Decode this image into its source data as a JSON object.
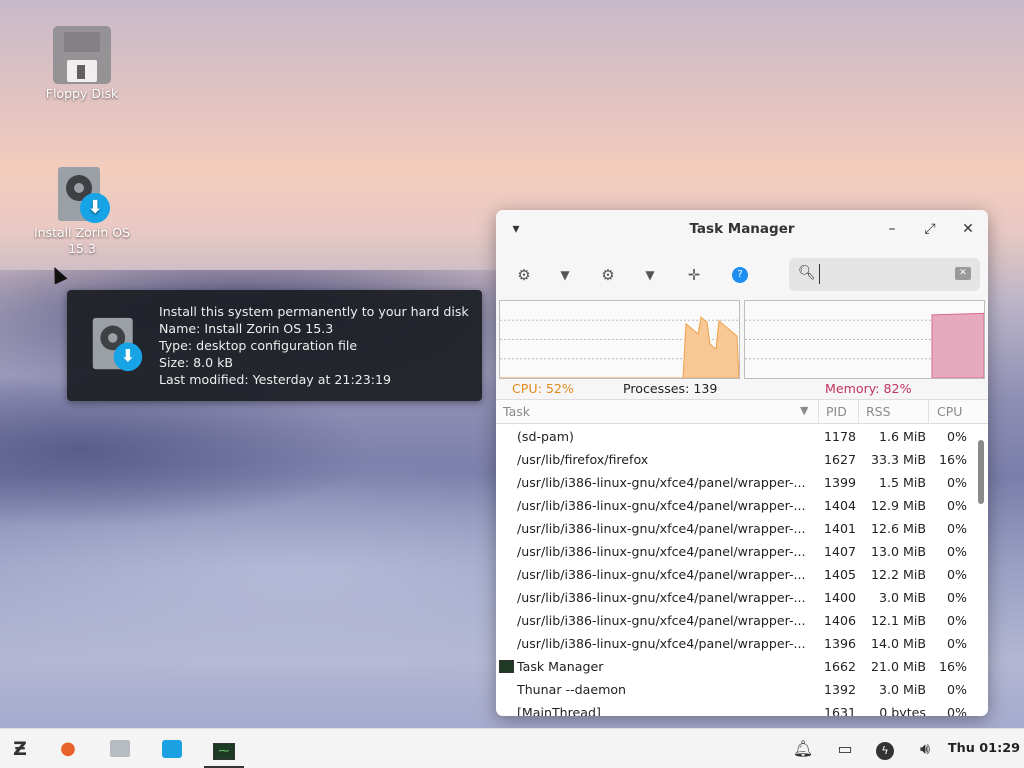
{
  "desktop": {
    "icons": [
      {
        "label": "Floppy Disk"
      },
      {
        "label": "Install Zorin OS 15.3"
      }
    ]
  },
  "tooltip": {
    "lines": [
      "Install this system permanently to your hard disk",
      "Name: Install Zorin OS 15.3",
      "Type: desktop configuration file",
      "Size: 8.0 kB",
      "Last modified: Yesterday at 21:23:19"
    ]
  },
  "window": {
    "title": "Task Manager",
    "search": {
      "value": "",
      "placeholder": ""
    },
    "stats": {
      "cpu": "CPU: 52%",
      "processes": "Processes: 139",
      "memory": "Memory: 82%"
    },
    "cpu_usage_percent": 52,
    "memory_usage_percent": 82,
    "columns": [
      "Task",
      "PID",
      "RSS",
      "CPU"
    ],
    "rows": [
      {
        "task": "(sd-pam)",
        "pid": "1178",
        "rss": "1.6 MiB",
        "cpu": "0%"
      },
      {
        "task": "/usr/lib/firefox/firefox",
        "pid": "1627",
        "rss": "33.3 MiB",
        "cpu": "16%"
      },
      {
        "task": "/usr/lib/i386-linux-gnu/xfce4/panel/wrapper-...",
        "pid": "1399",
        "rss": "1.5 MiB",
        "cpu": "0%"
      },
      {
        "task": "/usr/lib/i386-linux-gnu/xfce4/panel/wrapper-...",
        "pid": "1404",
        "rss": "12.9 MiB",
        "cpu": "0%"
      },
      {
        "task": "/usr/lib/i386-linux-gnu/xfce4/panel/wrapper-...",
        "pid": "1401",
        "rss": "12.6 MiB",
        "cpu": "0%"
      },
      {
        "task": "/usr/lib/i386-linux-gnu/xfce4/panel/wrapper-...",
        "pid": "1407",
        "rss": "13.0 MiB",
        "cpu": "0%"
      },
      {
        "task": "/usr/lib/i386-linux-gnu/xfce4/panel/wrapper-...",
        "pid": "1405",
        "rss": "12.2 MiB",
        "cpu": "0%"
      },
      {
        "task": "/usr/lib/i386-linux-gnu/xfce4/panel/wrapper-...",
        "pid": "1400",
        "rss": "3.0 MiB",
        "cpu": "0%"
      },
      {
        "task": "/usr/lib/i386-linux-gnu/xfce4/panel/wrapper-...",
        "pid": "1406",
        "rss": "12.1 MiB",
        "cpu": "0%"
      },
      {
        "task": "/usr/lib/i386-linux-gnu/xfce4/panel/wrapper-...",
        "pid": "1396",
        "rss": "14.0 MiB",
        "cpu": "0%"
      },
      {
        "task": "Task Manager",
        "pid": "1662",
        "rss": "21.0 MiB",
        "cpu": "16%",
        "icon": "task-manager-icon"
      },
      {
        "task": "Thunar --daemon",
        "pid": "1392",
        "rss": "3.0 MiB",
        "cpu": "0%"
      },
      {
        "task": "[MainThread]",
        "pid": "1631",
        "rss": "0 bytes",
        "cpu": "0%"
      }
    ]
  },
  "taskbar": {
    "clock": "Thu 01:29",
    "launchers": [
      "zorin-menu-icon",
      "firefox-icon",
      "files-icon",
      "software-store-icon",
      "task-manager-icon"
    ],
    "tray": [
      "notifications-icon",
      "display-icon",
      "power-icon",
      "volume-icon"
    ]
  },
  "colors": {
    "cpu_graph": "#f0a04b",
    "memory_graph": "#d86a8f",
    "installer_badge": "#16a4e7",
    "help_button": "#1e8ff0"
  }
}
